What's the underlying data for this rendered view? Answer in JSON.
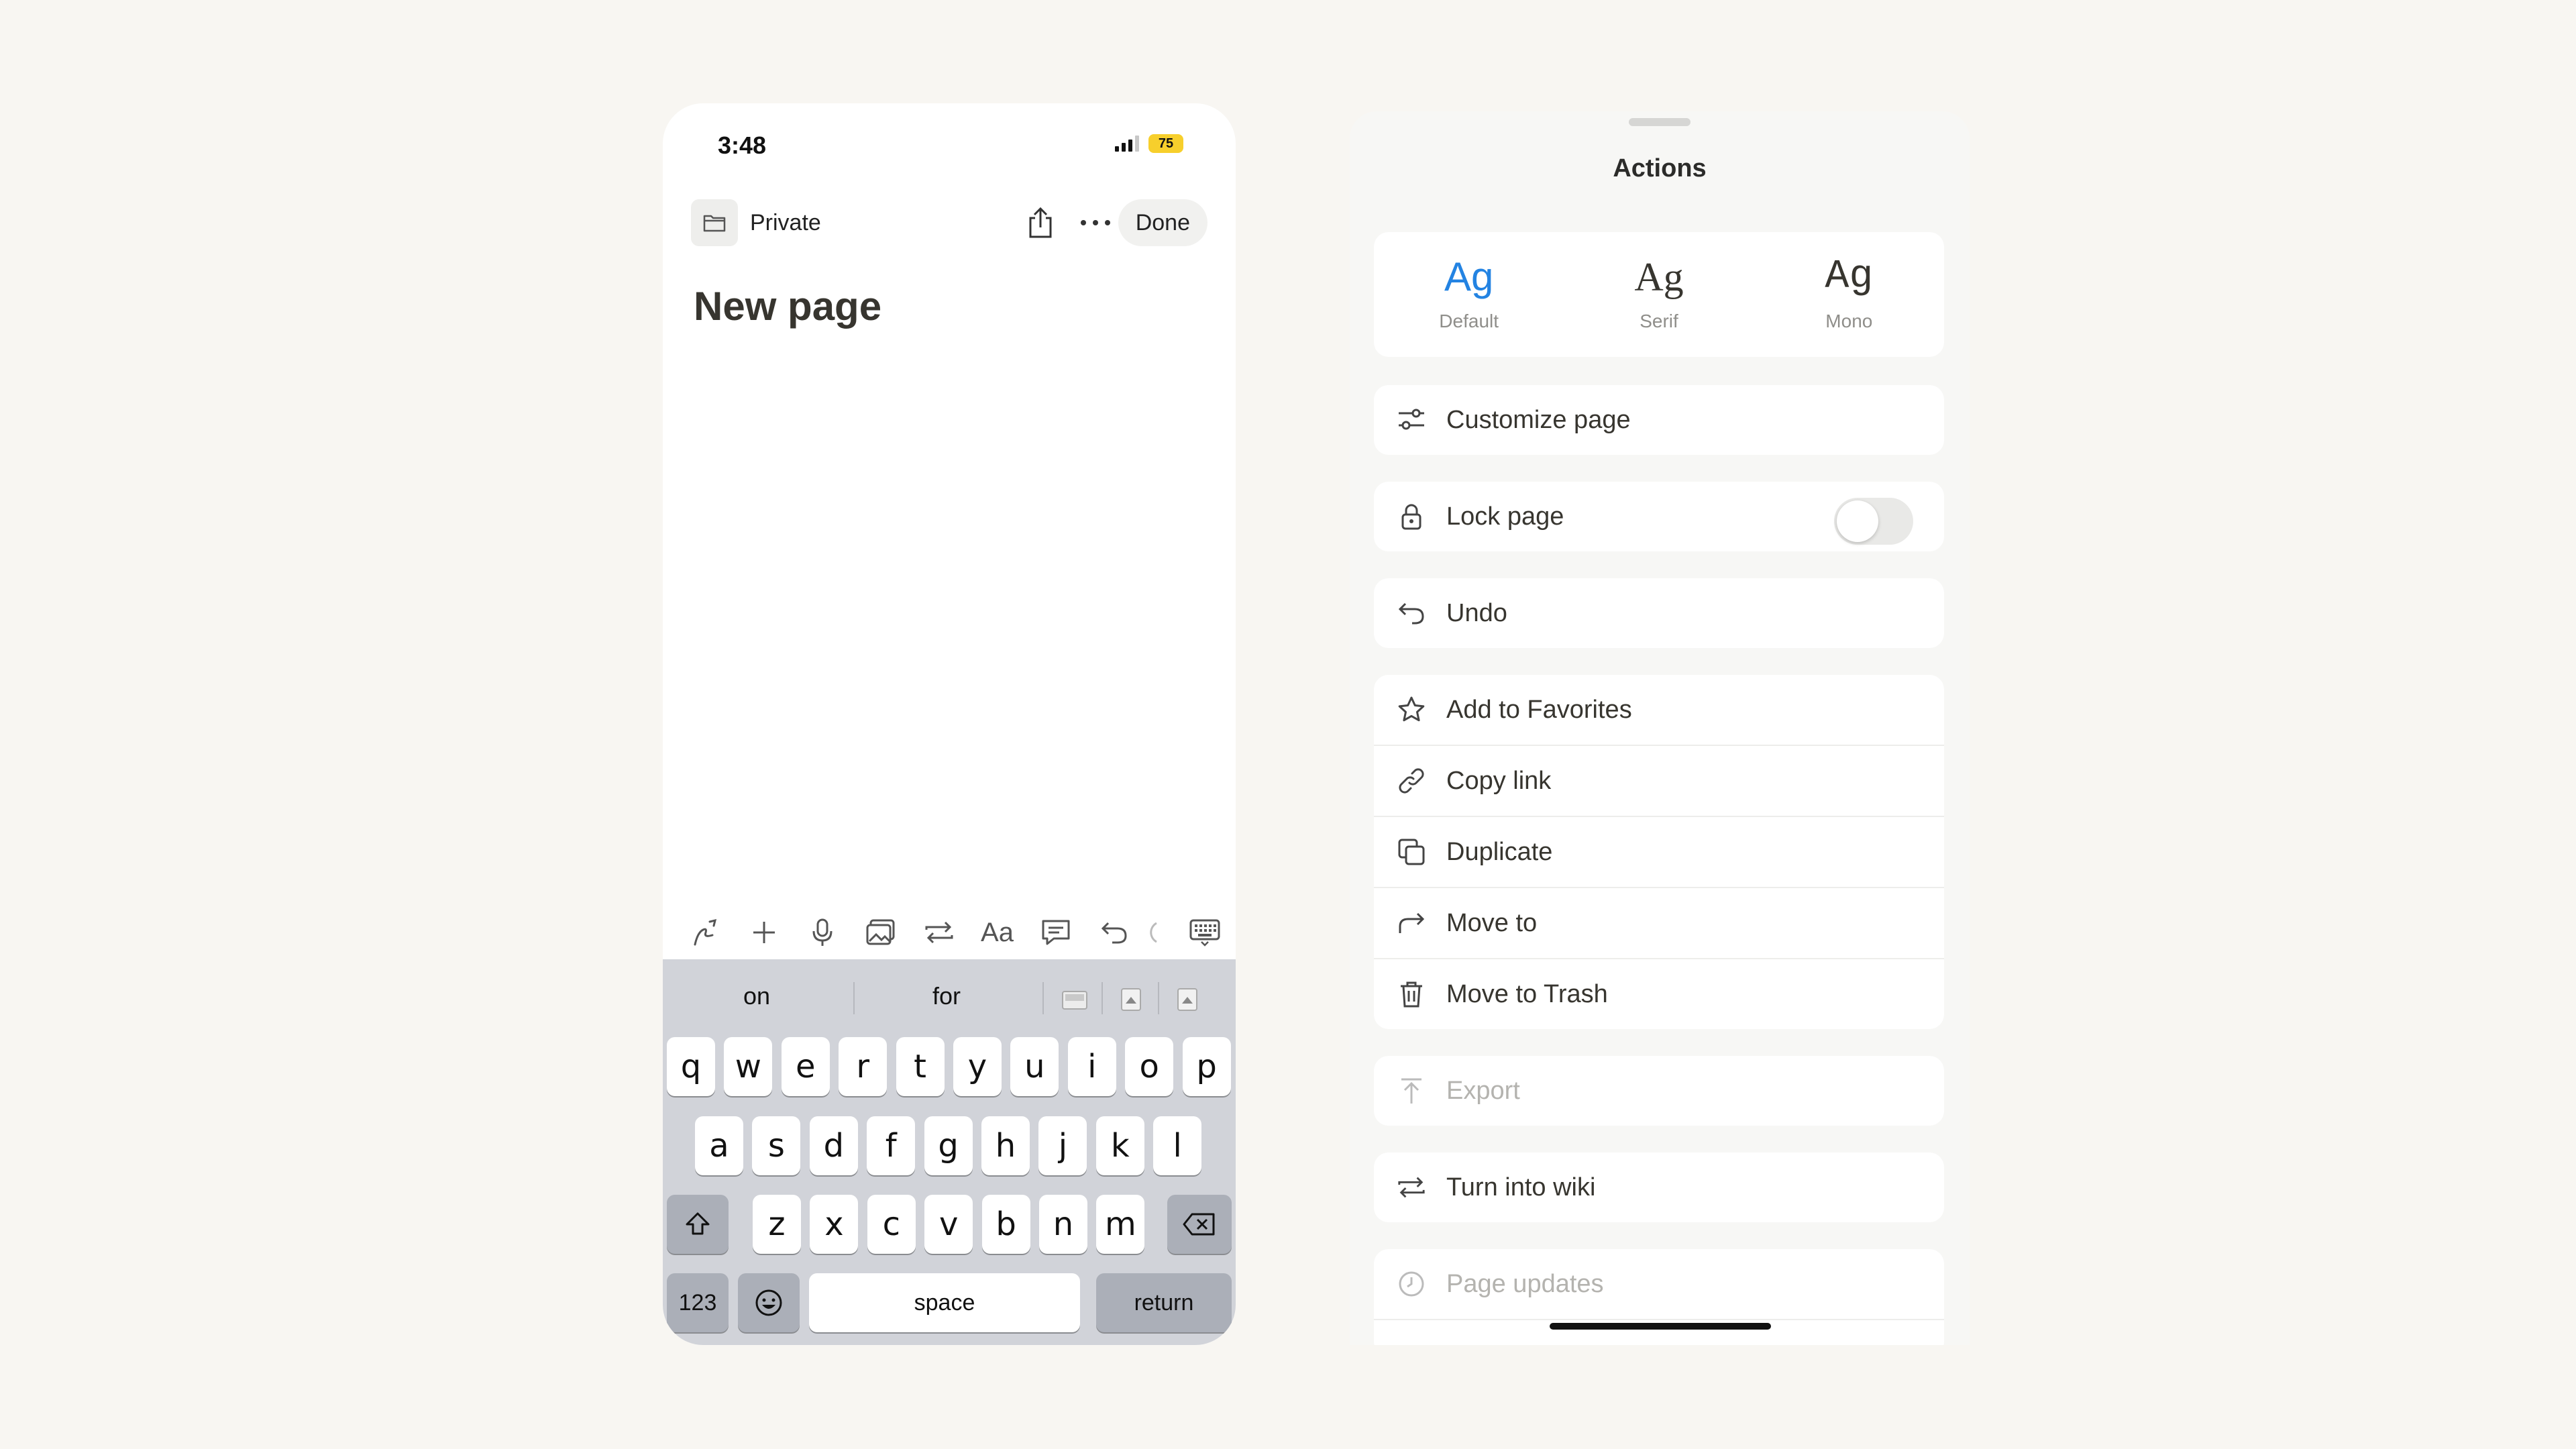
{
  "phone": {
    "status": {
      "time": "3:48",
      "battery": "75"
    },
    "nav": {
      "location": "Private",
      "done_label": "Done"
    },
    "page_title": "New page",
    "toolbar": {
      "icons": [
        "ai-pen-icon",
        "plus-icon",
        "microphone-icon",
        "image-icon",
        "turn-into-icon",
        "text-style-icon",
        "comment-icon",
        "undo-icon",
        "more-icon",
        "keyboard-hide-icon"
      ],
      "text_style_label": "Aa"
    },
    "keyboard": {
      "predictions": [
        "on",
        "for"
      ],
      "rows": [
        [
          "q",
          "w",
          "e",
          "r",
          "t",
          "y",
          "u",
          "i",
          "o",
          "p"
        ],
        [
          "a",
          "s",
          "d",
          "f",
          "g",
          "h",
          "j",
          "k",
          "l"
        ],
        [
          "z",
          "x",
          "c",
          "v",
          "b",
          "n",
          "m"
        ]
      ],
      "numbers_label": "123",
      "space_label": "space",
      "return_label": "return"
    }
  },
  "sheet": {
    "title": "Actions",
    "fonts": [
      {
        "glyph": "Ag",
        "label": "Default",
        "selected": true
      },
      {
        "glyph": "Ag",
        "label": "Serif",
        "selected": false
      },
      {
        "glyph": "Ag",
        "label": "Mono",
        "selected": false
      }
    ],
    "items": {
      "customize": "Customize page",
      "lock": "Lock page",
      "lock_enabled": false,
      "undo": "Undo",
      "favorites": "Add to Favorites",
      "copy_link": "Copy link",
      "duplicate": "Duplicate",
      "move_to": "Move to",
      "trash": "Move to Trash",
      "export": "Export",
      "wiki": "Turn into wiki",
      "updates": "Page updates"
    }
  },
  "colors": {
    "accent": "#2383e2",
    "battery": "#f7cf2c",
    "background": "#f8f6f2",
    "keyboard": "#d1d3d9"
  }
}
